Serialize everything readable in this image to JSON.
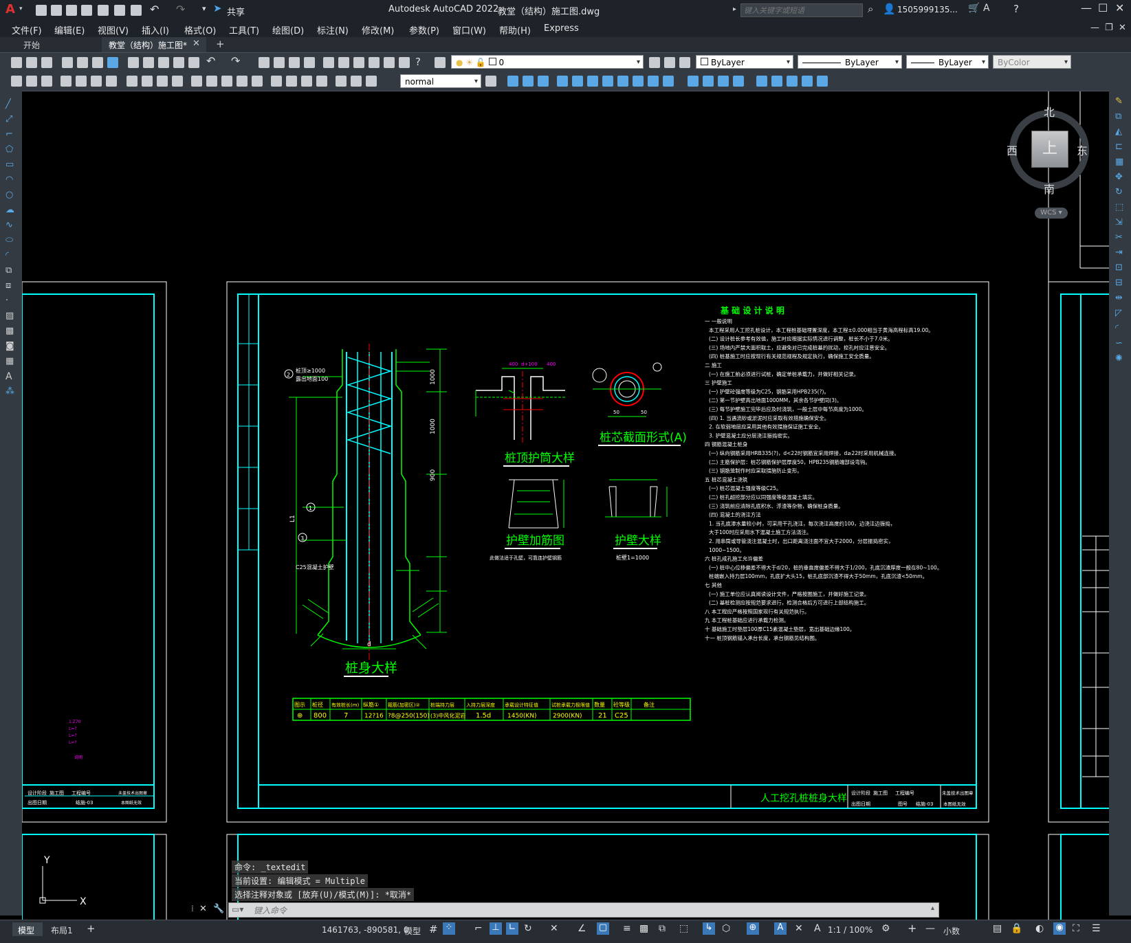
{
  "app": {
    "title": "Autodesk AutoCAD 2022",
    "document": "教堂（结构）施工图.dwg",
    "share_label": "共享",
    "search_placeholder": "键入关键字或短语",
    "user": "1505999135...",
    "logo": "A"
  },
  "menu": [
    "文件(F)",
    "编辑(E)",
    "视图(V)",
    "插入(I)",
    "格式(O)",
    "工具(T)",
    "绘图(D)",
    "标注(N)",
    "修改(M)",
    "参数(P)",
    "窗口(W)",
    "帮助(H)",
    "Express"
  ],
  "tabs": {
    "start": "开始",
    "active": "教堂（结构）施工图*"
  },
  "properties": {
    "layer_value": "0",
    "color": "ByLayer",
    "linetype": "ByLayer",
    "lineweight": "ByLayer",
    "plotstyle": "ByColor",
    "text_style": "normal"
  },
  "viewcube": {
    "north": "北",
    "south": "南",
    "east": "东",
    "west": "西",
    "top": "上",
    "wcs": "WCS"
  },
  "drawing": {
    "pile_title": "桩身大样",
    "top_casing_title": "桩顶护筒大样",
    "section_title": "桩芯截面形式(A)",
    "wall_rebar_title": "护壁加筋图",
    "wall_title": "护壁大样",
    "wall_note": "桩壁1=1000",
    "rebar_note": "此做法适于孔壁，可靠连护壁钢筋",
    "notes_title": "基 础 设 计 说 明",
    "sheet_title": "人工挖孔桩桩身大样",
    "table_headers": [
      "图示",
      "桩径",
      "有效桩长(m)",
      "纵筋①",
      "箍筋(加密区)②",
      "桩端持力层",
      "入持力层深度",
      "承载设计特征值",
      "试桩承载力极限值",
      "数量",
      "砼等级",
      "备注"
    ],
    "table_row": [
      "⊕",
      "800",
      "7",
      "12?16",
      "?8@250(150)",
      "(3)中风化泥岩",
      "1.5d",
      "1450(KN)",
      "2900(KN)",
      "21",
      "C25",
      ""
    ],
    "dim_labels": [
      "桩顶≥1000",
      "露出地面100",
      "C25混凝土护壁",
      "1000",
      "1000",
      "900",
      "d",
      "L1",
      "50",
      "50",
      "400",
      "d+100",
      "400"
    ],
    "notes_lines": [
      "一 一般说明",
      "本工程采用人工挖孔桩设计，本工程桩基础埋置深度，本工程±0.000相当于黄海高程标高19.00。",
      "(二) 设计桩长参考有效值，施工时应根据实际情况进行调整，桩长不小于7.0米。",
      "(三) 场地内严禁大面积取土，应避免对已完成桩基的扰动，挖孔时应注意安全。",
      "(四) 桩基施工时应按现行有关规范规程及规定执行，确保施工安全质量。",
      "二 施工",
      "(一) 在施工前必须进行试桩，确定单桩承载力，并做好相关记录。",
      "三 护壁施工",
      "(一) 护壁砼强度等级为C25，钢筋采用HPB235(?)。",
      "(二) 第一节护壁高出地面1000MM，其余各节护壁同(3)。",
      "(三) 每节护壁施工完毕后应及时浇筑，一般土层中每节高度为1000。",
      "(四) 1. 当遇流砂或淤泥时应采取有效措施确保安全。",
      "2. 在软弱地层应采用其他有效措施保证施工安全。",
      "3. 护壁混凝土应分层浇注振捣密实。",
      "四 钢筋混凝土桩身",
      "(一) 纵向钢筋采用HRB335(?)，d<22时钢筋宜采用焊接，d≥22时采用机械连接。",
      "(二) 主筋保护层：桩芯钢筋保护层厚度50，HPB235钢筋端部设弯钩。",
      "(三) 钢筋笼制作时应采取措施防止变形。",
      "五 桩芯混凝土浇筑",
      "(一) 桩芯混凝土强度等级C25。",
      "(二) 桩孔超挖部分应以同强度等级混凝土填实。",
      "(三) 浇筑前应清除孔底积水、浮渣等杂物，确保桩身质量。",
      "(四) 混凝土的浇注方法",
      "1. 当孔底渗水量较小时，可采用干孔浇注，每次浇注高度约100，边浇注边振捣，",
      "大于100时应采用水下混凝土施工方法浇注。",
      "2. 用串筒或导管浇注混凝土时，出口距离浇注面不宜大于2000，分层振捣密实，",
      "1000~1500。",
      "六 桩孔成孔施工允许偏差",
      "(一) 桩中心位移偏差不得大于d/20，桩的垂直度偏差不得大于1/200，孔底沉渣厚度一般在80~100。",
      "桩端嵌入持力层100mm，孔底扩大头15，桩孔底部沉渣不得大于50mm，孔底沉渣<50mm。",
      "七 其他",
      "(一) 施工单位应认真阅读设计文件，严格按图施工，并做好施工记录。",
      "(二) 基桩检测应按规范要求进行，检测合格后方可进行上部结构施工。",
      "八 本工程应严格按照国家现行有关规范执行。",
      "九 本工程桩基础应进行承载力检测。",
      "十 基础施工时垫层100厚C15素混凝土垫层，宽出基础边缘100。",
      "十一 桩顶钢筋锚入承台长度，承台钢筋见结构图。"
    ],
    "title_block": [
      "设计阶段",
      "施工图",
      "工程编号",
      "出图日期",
      "图号",
      "结施-03",
      "未盖技术出图章",
      "本图纸无效"
    ],
    "left_sheet_text": [
      "说明",
      "1.Z70",
      "L=?",
      "L=?",
      "L=?"
    ]
  },
  "command": {
    "line1": "命令: _textedit",
    "line2": "当前设置: 编辑模式 = Multiple",
    "line3": "选择注释对象或 [放弃(U)/模式(M)]: *取消*",
    "placeholder": "键入命令"
  },
  "status": {
    "model_tab": "模型",
    "layout_tab": "布局1",
    "coords": "1461763, -890581, 0",
    "model_button": "模型",
    "scale": "1:1 / 100%",
    "units": "小数"
  },
  "colors": {
    "green": "#00ff00",
    "cyan": "#00ffff",
    "white": "#ffffff",
    "magenta": "#ff00ff",
    "red": "#ff0000",
    "yellow": "#ffff00"
  }
}
